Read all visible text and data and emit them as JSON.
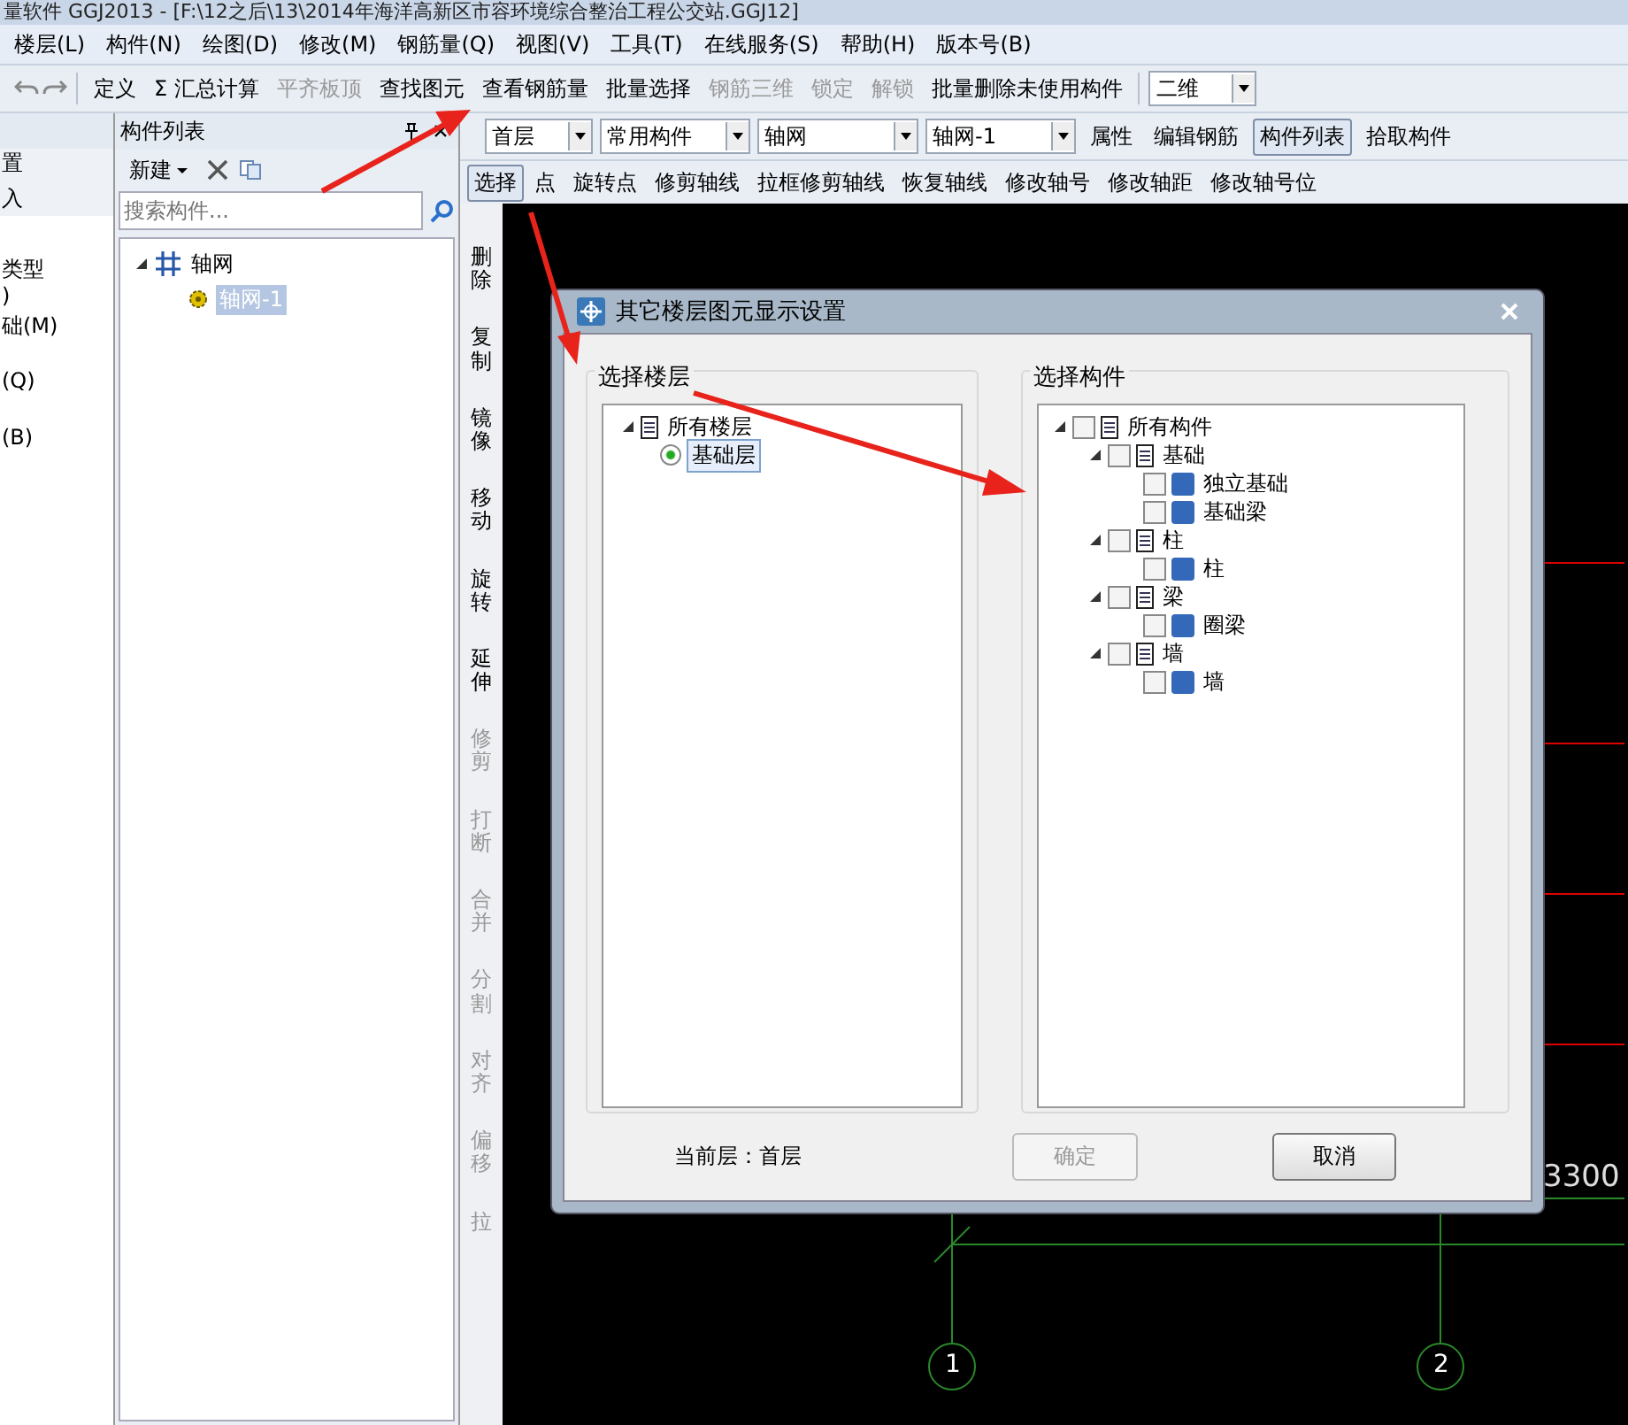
{
  "window": {
    "title": "量软件 GGJ2013 - [F:\\12之后\\13\\2014年海洋高新区市容环境综合整治工程公交站.GGJ12]"
  },
  "menu": [
    "楼层(L)",
    "构件(N)",
    "绘图(D)",
    "修改(M)",
    "钢筋量(Q)",
    "视图(V)",
    "工具(T)",
    "在线服务(S)",
    "帮助(H)",
    "版本号(B)"
  ],
  "main_toolbar": [
    {
      "label": "定义",
      "disabled": false
    },
    {
      "label": "Σ 汇总计算",
      "disabled": false
    },
    {
      "label": "平齐板顶",
      "disabled": true
    },
    {
      "label": "查找图元",
      "disabled": false
    },
    {
      "label": "查看钢筋量",
      "disabled": false
    },
    {
      "label": "批量选择",
      "disabled": false
    },
    {
      "label": "钢筋三维",
      "disabled": true
    },
    {
      "label": "锁定",
      "disabled": true
    },
    {
      "label": "解锁",
      "disabled": true
    },
    {
      "label": "批量删除未使用构件",
      "disabled": false
    }
  ],
  "view_mode": "二维",
  "left_panel": {
    "items": [
      "置",
      "入",
      "类型",
      ")",
      "础(M)",
      "(Q)",
      "(B)"
    ]
  },
  "component_panel": {
    "title": "构件列表",
    "new_button": "新建",
    "search": {
      "placeholder": "搜索构件..."
    },
    "tree": [
      {
        "label": "轴网",
        "expanded": true,
        "selected": false,
        "children": [
          {
            "label": "轴网-1",
            "selected": true
          }
        ]
      }
    ]
  },
  "selector_bar": {
    "dropdowns": [
      "首层",
      "常用构件",
      "轴网",
      "轴网-1"
    ],
    "buttons": [
      {
        "label": "属性",
        "pressed": false
      },
      {
        "label": "编辑钢筋",
        "pressed": false
      },
      {
        "label": "构件列表",
        "pressed": true
      },
      {
        "label": "拾取构件",
        "pressed": false
      }
    ]
  },
  "draw_bar": [
    {
      "label": "选择",
      "pressed": true
    },
    {
      "label": "点",
      "pressed": false
    },
    {
      "label": "旋转点",
      "pressed": false
    },
    {
      "label": "修剪轴线",
      "pressed": false
    },
    {
      "label": "拉框修剪轴线",
      "pressed": false
    },
    {
      "label": "恢复轴线",
      "pressed": false
    },
    {
      "label": "修改轴号",
      "pressed": false
    },
    {
      "label": "修改轴距",
      "pressed": false
    },
    {
      "label": "修改轴号位",
      "pressed": false
    }
  ],
  "edit_bar": [
    {
      "label": "删除",
      "disabled": false
    },
    {
      "label": "复制",
      "disabled": false
    },
    {
      "label": "镜像",
      "disabled": false
    },
    {
      "label": "移动",
      "disabled": false
    },
    {
      "label": "旋转",
      "disabled": false
    },
    {
      "label": "延伸",
      "disabled": false
    },
    {
      "label": "修剪",
      "disabled": true
    },
    {
      "label": "打断",
      "disabled": true
    },
    {
      "label": "合并",
      "disabled": true
    },
    {
      "label": "分割",
      "disabled": true
    },
    {
      "label": "对齐",
      "disabled": true
    },
    {
      "label": "偏移",
      "disabled": true
    },
    {
      "label": "拉",
      "disabled": true
    }
  ],
  "canvas": {
    "dimension": "3300",
    "axes": [
      "1",
      "2"
    ]
  },
  "dialog": {
    "title": "其它楼层图元显示设置",
    "floor_group": "选择楼层",
    "component_group": "选择构件",
    "floors": [
      {
        "label": "所有楼层",
        "expanded": true,
        "children": [
          {
            "label": "基础层",
            "selected": true
          }
        ]
      }
    ],
    "components": [
      {
        "label": "所有构件",
        "expanded": true,
        "checked": false,
        "children": [
          {
            "label": "基础",
            "expanded": true,
            "checked": false,
            "children": [
              {
                "label": "独立基础",
                "checked": false
              },
              {
                "label": "基础梁",
                "checked": false
              }
            ]
          },
          {
            "label": "柱",
            "expanded": true,
            "checked": false,
            "children": [
              {
                "label": "柱",
                "checked": false
              }
            ]
          },
          {
            "label": "梁",
            "expanded": true,
            "checked": false,
            "children": [
              {
                "label": "圈梁",
                "checked": false
              }
            ]
          },
          {
            "label": "墙",
            "expanded": true,
            "checked": false,
            "children": [
              {
                "label": "墙",
                "checked": false
              }
            ]
          }
        ]
      }
    ],
    "current_floor": "当前层：首层",
    "ok_button": {
      "label": "确定",
      "disabled": true
    },
    "cancel_button": {
      "label": "取消",
      "disabled": false
    }
  }
}
